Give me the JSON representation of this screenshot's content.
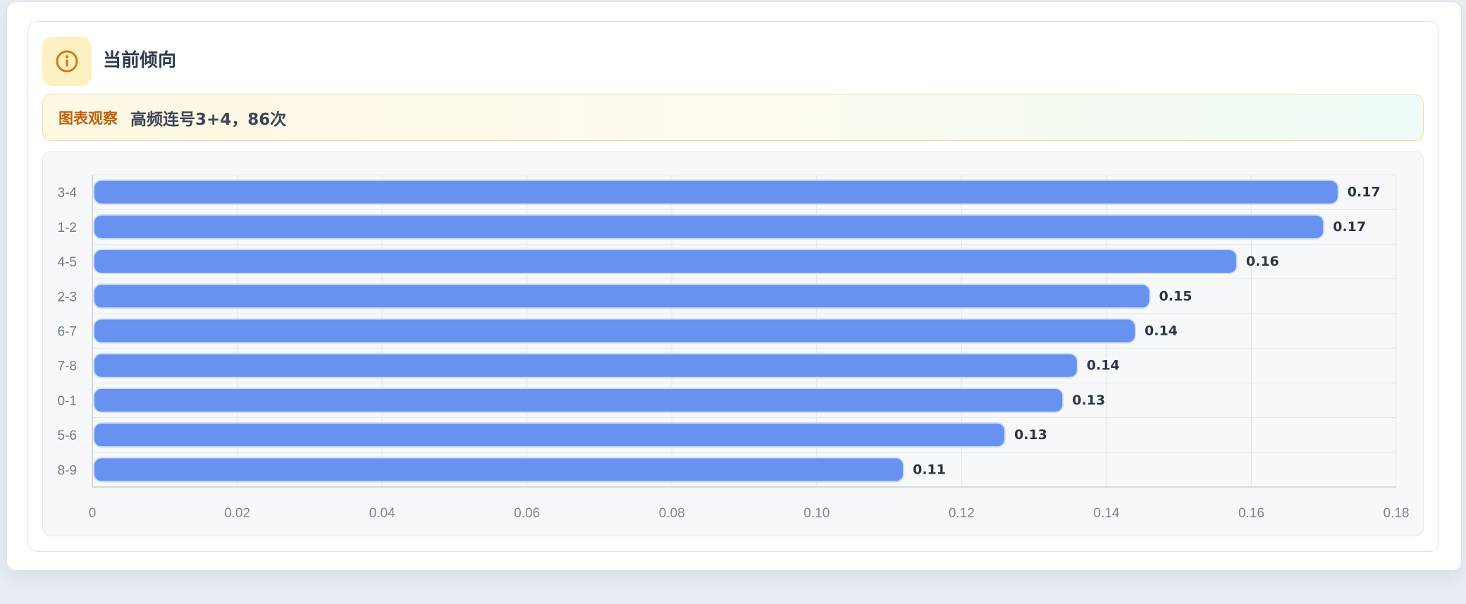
{
  "panel": {
    "title": "当前倾向",
    "icon": "info-circle-icon",
    "icon_color": "#d9780f"
  },
  "observation": {
    "label": "图表观察",
    "text": "高频连号3+4，86次"
  },
  "chart_data": {
    "type": "bar",
    "orientation": "horizontal",
    "categories": [
      "3-4",
      "1-2",
      "4-5",
      "2-3",
      "6-7",
      "7-8",
      "0-1",
      "5-6",
      "8-9"
    ],
    "values": [
      0.172,
      0.17,
      0.158,
      0.146,
      0.144,
      0.136,
      0.134,
      0.126,
      0.112
    ],
    "value_labels": [
      "0.17",
      "0.17",
      "0.16",
      "0.15",
      "0.14",
      "0.14",
      "0.13",
      "0.13",
      "0.11"
    ],
    "xlim": [
      0,
      0.18
    ],
    "xticks": [
      "0",
      "0.02",
      "0.04",
      "0.06",
      "0.08",
      "0.10",
      "0.12",
      "0.14",
      "0.16",
      "0.18"
    ],
    "title": "",
    "xlabel": "",
    "ylabel": "",
    "grid": true,
    "bar_color": "#6892f0"
  }
}
